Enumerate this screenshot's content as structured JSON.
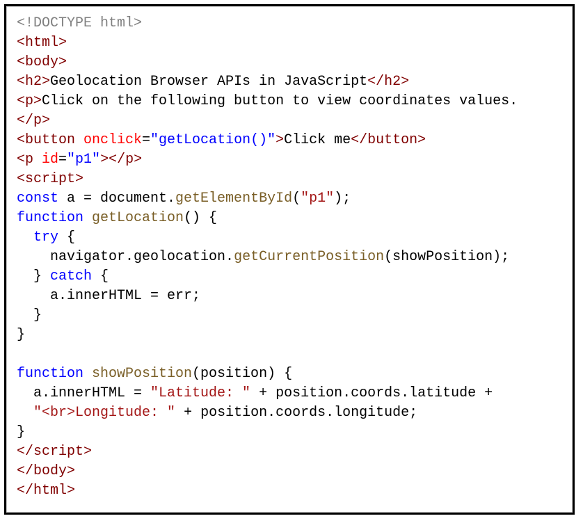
{
  "code": {
    "doctype": "<!DOCTYPE html>",
    "html_open": "<html>",
    "body_open": "<body>",
    "h2_open": "<h2>",
    "h2_text": "Geolocation Browser APIs in JavaScript",
    "h2_close": "</h2>",
    "p_open": "<p>",
    "p_text": "Click on the following button to view coordinates values.",
    "p_close": "</p>",
    "button_open_tag": "<button",
    "button_attr_name": " onclick",
    "button_attr_eq": "=",
    "button_attr_val": "\"getLocation()\"",
    "button_open_end": ">",
    "button_text": "Click me",
    "button_close": "</button>",
    "p2_open_tag": "<p",
    "p2_attr_name": " id",
    "p2_attr_eq": "=",
    "p2_attr_val": "\"p1\"",
    "p2_open_end": ">",
    "p2_close": "</p>",
    "script_open": "<script>",
    "const_kw": "const",
    "const_line_rest": " a = document.",
    "getElById": "getElementById",
    "getElById_arg_open": "(",
    "getElById_arg": "\"p1\"",
    "getElById_arg_close": ");",
    "function_kw1": "function",
    "func_name1": " getLocation",
    "func1_rest": "() {",
    "try_kw": "  try",
    "try_rest": " {",
    "nav_line_a": "    navigator.geolocation.",
    "nav_line_b": "getCurrentPosition",
    "nav_line_c": "(showPosition);",
    "catch_line_a": "  } ",
    "catch_kw": "catch",
    "catch_line_b": " {",
    "catch_body": "    a.innerHTML = err;",
    "catch_close": "  }",
    "func1_close": "}",
    "function_kw2": "function",
    "func_name2": " showPosition",
    "func2_rest": "(position) {",
    "show_line1_a": "  a.innerHTML = ",
    "show_line1_b": "\"Latitude: \"",
    "show_line1_c": " + position.coords.latitude +",
    "show_line2_a": "  ",
    "show_line2_b": "\"<br>Longitude: \"",
    "show_line2_c": " + position.coords.longitude;",
    "func2_close": "}",
    "script_close": "</script>",
    "body_close": "</body>",
    "html_close": "</html>"
  }
}
